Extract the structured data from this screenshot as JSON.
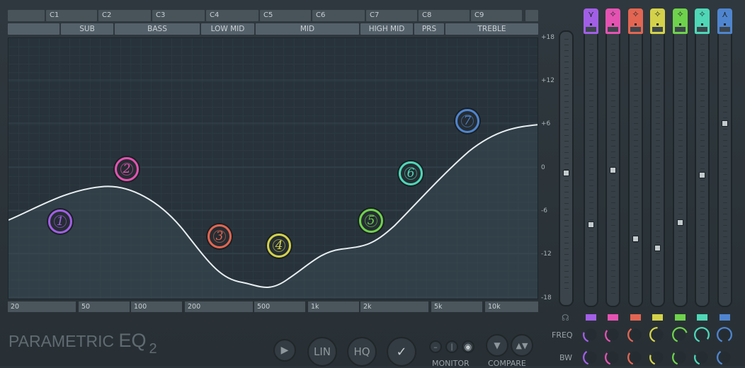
{
  "colors": {
    "ch1": "#a25fe6",
    "ch2": "#e453b2",
    "ch3": "#e36652",
    "ch4": "#d4d24a",
    "ch5": "#6fd24c",
    "ch6": "#4fd7b7",
    "ch7": "#4f85cf"
  },
  "target_row": [
    "",
    "C1",
    "C2",
    "C3",
    "C4",
    "C5",
    "C6",
    "C7",
    "C8",
    "C9",
    ""
  ],
  "bands": [
    "",
    "SUB",
    "BASS",
    "LOW MID",
    "MID",
    "HIGH MID",
    "PRS",
    "TREBLE"
  ],
  "db_scale": [
    "+18",
    "+12",
    "+6",
    "0",
    "-6",
    "-12",
    "-18"
  ],
  "freq_scale": [
    "20",
    "50",
    "100",
    "200",
    "500",
    "1k",
    "2k",
    "5k",
    "10k"
  ],
  "nodes": [
    {
      "label": "1",
      "color": "ch1"
    },
    {
      "label": "2",
      "color": "ch2"
    },
    {
      "label": "3",
      "color": "ch3"
    },
    {
      "label": "4",
      "color": "ch4"
    },
    {
      "label": "5",
      "color": "ch5"
    },
    {
      "label": "6",
      "color": "ch6"
    },
    {
      "label": "7",
      "color": "ch7"
    }
  ],
  "channels": [
    {
      "name": "1",
      "shape": "low-shelf-icon",
      "gain_db": -7.5,
      "color": "ch1"
    },
    {
      "name": "2",
      "shape": "peaking-icon",
      "gain_db": 0,
      "color": "ch2"
    },
    {
      "name": "3",
      "shape": "peaking-icon",
      "gain_db": -9.5,
      "color": "ch3"
    },
    {
      "name": "4",
      "shape": "peaking-icon",
      "gain_db": -10.8,
      "color": "ch4"
    },
    {
      "name": "5",
      "shape": "peaking-icon",
      "gain_db": -7.3,
      "color": "ch5"
    },
    {
      "name": "6",
      "shape": "peaking-icon",
      "gain_db": -0.7,
      "color": "ch6"
    },
    {
      "name": "7",
      "shape": "high-shelf-icon",
      "gain_db": 6.5,
      "color": "ch7"
    }
  ],
  "master_gain_db": 0,
  "labels": {
    "freq": "FREQ",
    "bw": "BW",
    "brand_main": "PARAMETRIC ",
    "brand_eq": "EQ",
    "brand_num": "2",
    "lin": "LIN",
    "hq": "HQ",
    "monitor": "MONITOR",
    "compare": "COMPARE"
  }
}
